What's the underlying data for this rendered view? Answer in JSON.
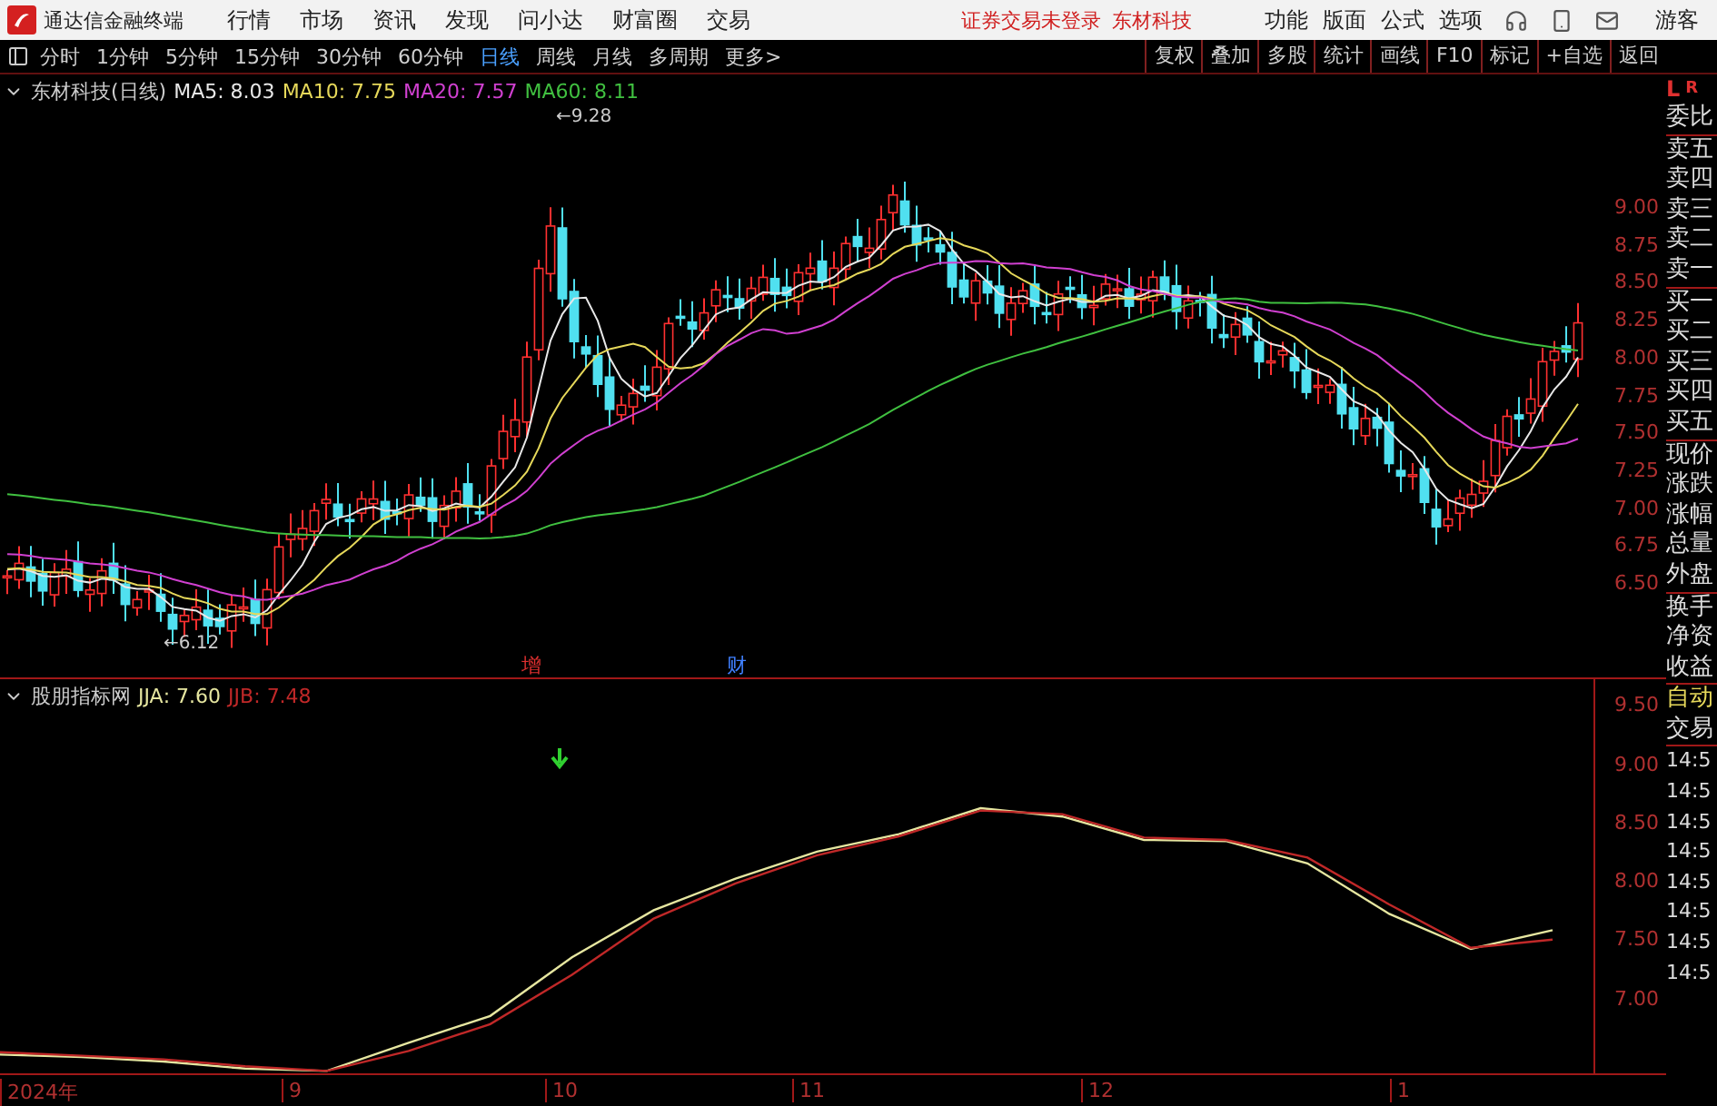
{
  "title_bar": {
    "app_name": "通达信金融终端",
    "menu": [
      "行情",
      "市场",
      "资讯",
      "发现",
      "问小达",
      "财富圈",
      "交易"
    ],
    "notices": [
      "证券交易未登录",
      "东材科技"
    ],
    "tools": [
      "功能",
      "版面",
      "公式",
      "选项"
    ],
    "user": "游客"
  },
  "period_bar": {
    "periods": [
      {
        "label": "分时",
        "selected": false
      },
      {
        "label": "1分钟",
        "selected": false
      },
      {
        "label": "5分钟",
        "selected": false
      },
      {
        "label": "15分钟",
        "selected": false
      },
      {
        "label": "30分钟",
        "selected": false
      },
      {
        "label": "60分钟",
        "selected": false
      },
      {
        "label": "日线",
        "selected": true
      },
      {
        "label": "周线",
        "selected": false
      },
      {
        "label": "月线",
        "selected": false
      },
      {
        "label": "多周期",
        "selected": false
      },
      {
        "label": "更多>",
        "selected": false
      }
    ],
    "actions": [
      "复权",
      "叠加",
      "多股",
      "统计",
      "画线",
      "F10",
      "标记",
      "+自选",
      "返回"
    ]
  },
  "main_chart": {
    "title": "东材科技(日线)",
    "ma_lines": [
      {
        "label": "MA5: 8.03",
        "color": "#e8e8e8"
      },
      {
        "label": "MA10: 7.75",
        "color": "#e6d85a"
      },
      {
        "label": "MA20: 7.57",
        "color": "#d040d0"
      },
      {
        "label": "MA60: 8.11",
        "color": "#40c040"
      }
    ],
    "high_label": "←9.28",
    "low_label": "←6.12",
    "markers": [
      {
        "text": "增",
        "color": "#e03030"
      },
      {
        "text": "财",
        "color": "#4080ff"
      }
    ],
    "price_ticks": [
      "9.00",
      "8.75",
      "8.50",
      "8.25",
      "8.00",
      "7.75",
      "7.50",
      "7.25",
      "7.00",
      "6.75",
      "6.50"
    ]
  },
  "indicator": {
    "name": "股朋指标网",
    "readings": [
      {
        "separator": ":",
        "value": "7.60"
      },
      {
        "separator": ":",
        "value": "7.48"
      }
    ],
    "chart_data": {
      "type": "line",
      "categories": [
        null,
        null,
        null,
        null,
        null,
        null,
        null,
        null,
        null,
        null,
        null,
        null,
        null,
        null,
        null,
        null,
        null,
        null,
        null,
        null
      ],
      "ylim": [
        6.36,
        9.72
      ],
      "yticks": [
        {
          "value": 9.5,
          "label": "9.50"
        },
        {
          "value": 9,
          "label": "9.00"
        },
        {
          "value": 8.5,
          "label": "8.50"
        },
        {
          "value": 8,
          "label": "8.00"
        },
        {
          "value": 7.5,
          "label": "7.50"
        },
        {
          "value": 7,
          "label": "7.00"
        }
      ],
      "series": [
        {
          "name": "JJA",
          "color": "#e6e6a0",
          "values": [
            6.52,
            6.5,
            6.46,
            6.4,
            6.38,
            6.62,
            6.85,
            7.35,
            7.75,
            8.02,
            8.25,
            8.4,
            8.62,
            8.55,
            8.35,
            8.34,
            8.15,
            7.72,
            7.42,
            7.58
          ]
        },
        {
          "name": "JJB",
          "color": "#c02828",
          "values": [
            6.54,
            6.51,
            6.48,
            6.42,
            6.38,
            6.55,
            6.78,
            7.2,
            7.68,
            7.98,
            8.22,
            8.38,
            8.6,
            8.57,
            8.37,
            8.35,
            8.2,
            7.8,
            7.43,
            7.5
          ]
        }
      ]
    }
  },
  "time_axis": [
    "2024年",
    "9",
    "10",
    "11",
    "12",
    "1"
  ],
  "right_panel": {
    "top_marks": [
      "L",
      "R"
    ],
    "labels": [
      "委比",
      "卖五",
      "卖四",
      "卖三",
      "卖二",
      "卖一",
      "买一",
      "买二",
      "买三",
      "买四",
      "买五",
      "现价",
      "涨跌",
      "涨幅",
      "总量",
      "外盘",
      "换手",
      "净资",
      "收益"
    ],
    "auto_label": "自动",
    "trade_label": "交易",
    "times": [
      "14:5",
      "14:5",
      "14:5",
      "14:5",
      "14:5",
      "14:5",
      "14:5",
      "14:5"
    ]
  }
}
